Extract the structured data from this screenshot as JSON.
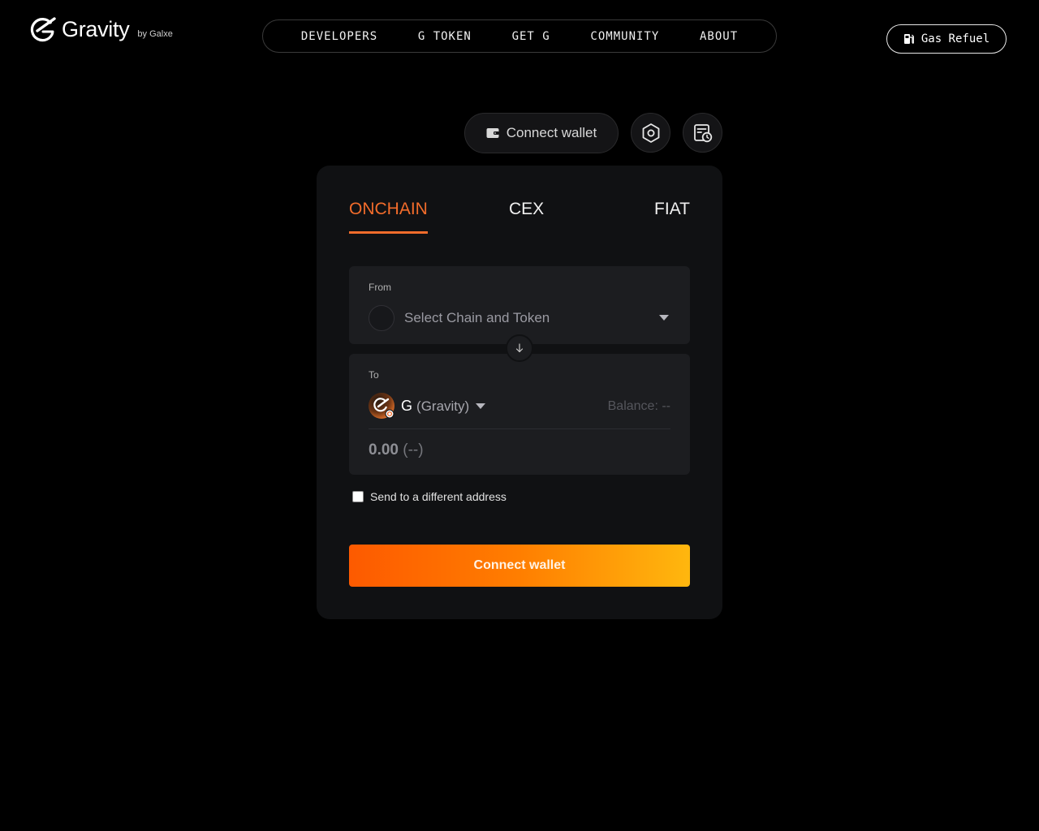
{
  "header": {
    "logo_text": "Gravity",
    "logo_by": "by Galxe",
    "nav": [
      "DEVELOPERS",
      "G TOKEN",
      "GET G",
      "COMMUNITY",
      "ABOUT"
    ],
    "gas_refuel_label": "Gas Refuel"
  },
  "toolbar": {
    "connect_wallet_label": "Connect wallet",
    "settings_icon": "hexagon-settings-icon",
    "history_icon": "history-icon"
  },
  "tabs": [
    "ONCHAIN",
    "CEX",
    "FIAT"
  ],
  "active_tab": "ONCHAIN",
  "from": {
    "label": "From",
    "placeholder": "Select Chain and Token"
  },
  "to": {
    "label": "To",
    "token_symbol": "G",
    "token_name": "(Gravity)",
    "balance": "Balance: --",
    "amount": "0.00",
    "amount_usd": "(--)"
  },
  "send_different_address_label": "Send to a different address",
  "send_different_address_checked": false,
  "connect_wallet_button": "Connect wallet",
  "colors": {
    "accent": "#f26c2b",
    "gradient_start": "#fd5a00",
    "gradient_end": "#ffb70e",
    "background": "#000000",
    "card": "#101113"
  }
}
